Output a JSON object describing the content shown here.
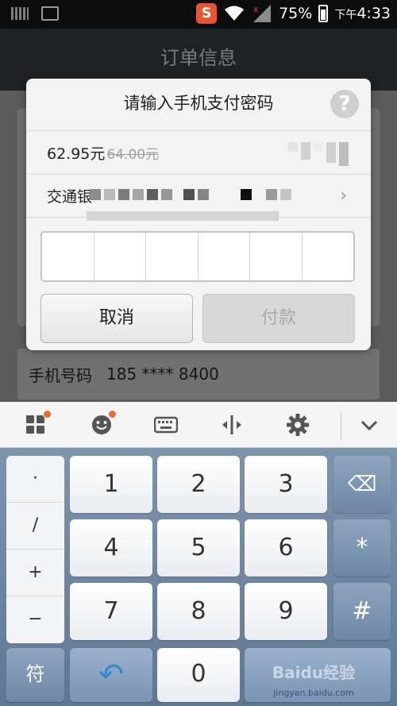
{
  "status_bar": {
    "battery": "75%",
    "time_prefix": "下午",
    "time": "4:33",
    "app_badge": "S"
  },
  "screen_title": "订单信息",
  "background": {
    "phone_label": "手机号码",
    "phone_value": "185 **** 8400"
  },
  "dialog": {
    "title": "请输入手机支付密码",
    "help_glyph": "?",
    "amount": "62.95元",
    "original_amount": "64.00元",
    "bank": "交通银",
    "chevron": "›",
    "cancel_label": "取消",
    "pay_label": "付款"
  },
  "keyboard": {
    "toolbar_icons": [
      "apps-icon",
      "emoji-icon",
      "keyboard-icon",
      "cursor-icon",
      "settings-icon",
      "collapse-icon"
    ],
    "symbols": [
      "·",
      "/",
      "+",
      "−"
    ],
    "keys": [
      [
        "1",
        "2",
        "3"
      ],
      [
        "4",
        "5",
        "6"
      ],
      [
        "7",
        "8",
        "9"
      ]
    ],
    "zero": "0",
    "side_keys": {
      "delete": "⌫",
      "star": "*",
      "hash": "#"
    },
    "sym_label": "符",
    "back_glyph": "↶",
    "watermark": "Baidu经验",
    "watermark_url": "jingyan.baidu.com"
  }
}
